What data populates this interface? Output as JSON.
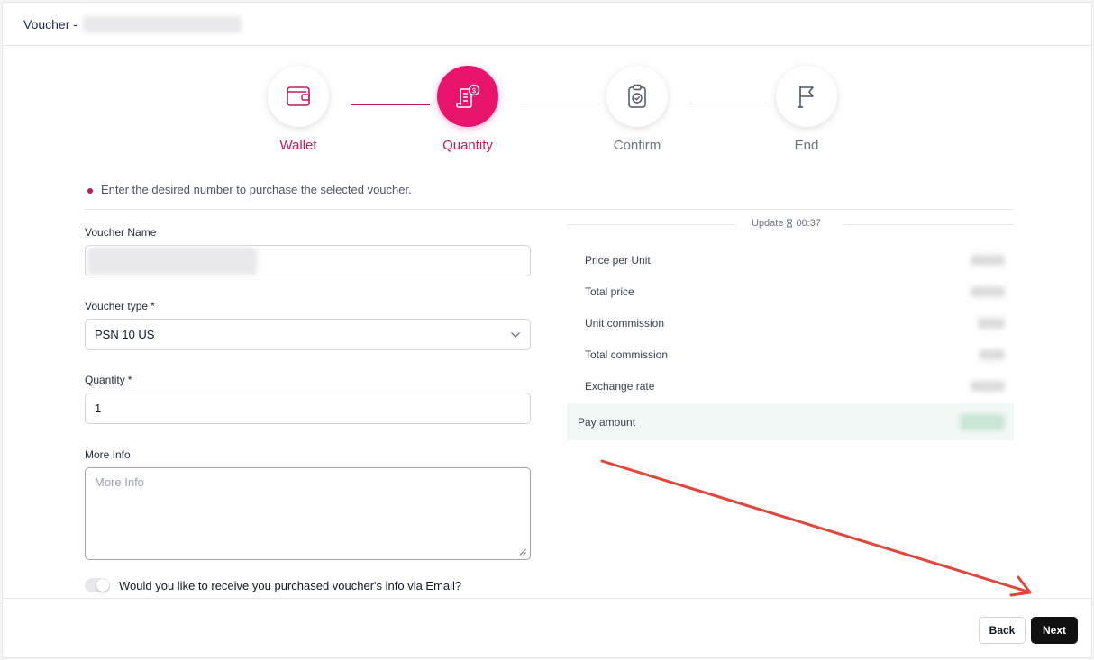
{
  "header": {
    "title": "Voucher -"
  },
  "stepper": {
    "steps": [
      {
        "label": "Wallet",
        "icon": "wallet-icon",
        "state": "done"
      },
      {
        "label": "Quantity",
        "icon": "invoice-dollar-icon",
        "state": "active"
      },
      {
        "label": "Confirm",
        "icon": "clipboard-check-icon",
        "state": "pending"
      },
      {
        "label": "End",
        "icon": "flag-icon",
        "state": "pending"
      }
    ]
  },
  "notice": {
    "text": "Enter the desired number to purchase the selected voucher."
  },
  "form": {
    "voucher_name": {
      "label": "Voucher Name"
    },
    "voucher_type": {
      "label": "Voucher type",
      "required": "*",
      "value": "PSN 10 US"
    },
    "quantity": {
      "label": "Quantity",
      "required": "*",
      "value": "1"
    },
    "more_info": {
      "label": "More Info",
      "placeholder": "More Info"
    },
    "email_toggle": {
      "label": "Would you like to receive you purchased voucher's info via Email?"
    }
  },
  "summary": {
    "update_label": "Update",
    "timer": "00:37",
    "rows": [
      {
        "label": "Price per Unit"
      },
      {
        "label": "Total price"
      },
      {
        "label": "Unit commission"
      },
      {
        "label": "Total commission"
      },
      {
        "label": "Exchange rate"
      }
    ],
    "pay_amount": {
      "label": "Pay amount"
    }
  },
  "footer": {
    "back_label": "Back",
    "next_label": "Next"
  },
  "colors": {
    "accent": "#e8146c",
    "accent_dark": "#c2185b",
    "pay_bg": "#f2f8f5",
    "arrow": "#e0463a"
  }
}
